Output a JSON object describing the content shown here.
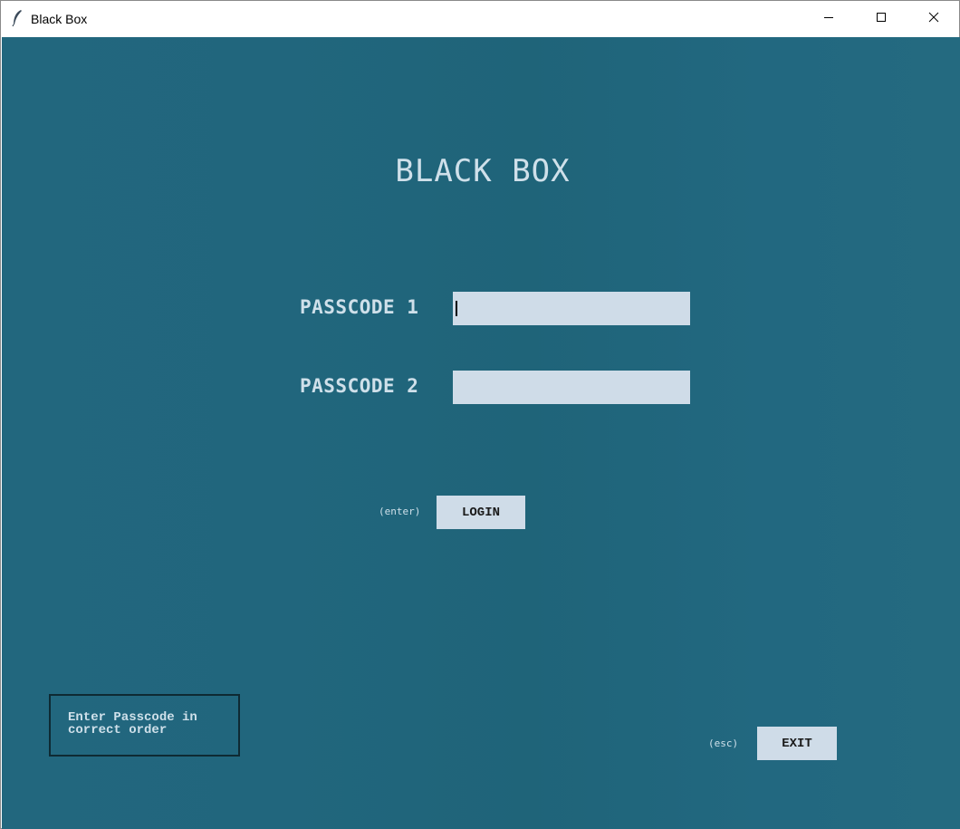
{
  "window": {
    "title": "Black Box",
    "controls": {
      "minimize_icon": "minimize-icon",
      "maximize_icon": "maximize-icon",
      "close_icon": "close-icon"
    }
  },
  "colors": {
    "background": "#21667d",
    "text": "#cfe0ea",
    "field_bg": "#cfdce8",
    "status_border": "#0e2a33"
  },
  "main": {
    "heading": "BLACK BOX",
    "fields": [
      {
        "label": "PASSCODE 1",
        "value": "",
        "placeholder": ""
      },
      {
        "label": "PASSCODE 2",
        "value": "",
        "placeholder": ""
      }
    ],
    "login": {
      "hint": "(enter)",
      "label": "LOGIN"
    },
    "status_message": "Enter Passcode in\ncorrect order",
    "exit": {
      "hint": "(esc)",
      "label": "EXIT"
    }
  }
}
